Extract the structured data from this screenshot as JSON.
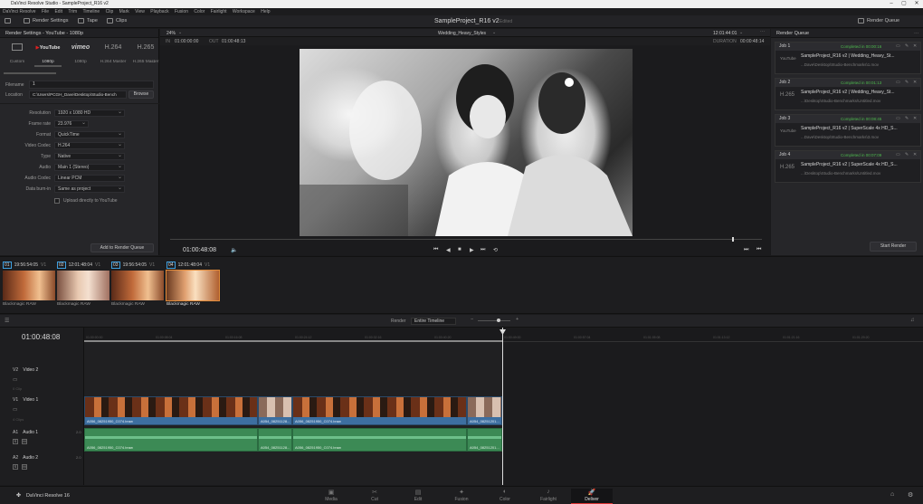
{
  "window": {
    "title": "DaVinci Resolve Studio - SampleProject_R16 v2"
  },
  "menu": [
    "DaVinci Resolve",
    "File",
    "Edit",
    "Trim",
    "Timeline",
    "Clip",
    "Mark",
    "View",
    "Playback",
    "Fusion",
    "Color",
    "Fairlight",
    "Workspace",
    "Help"
  ],
  "toolbar": {
    "render_settings": "Render Settings",
    "tape": "Tape",
    "clips": "Clips",
    "project_title": "SampleProject_R16 v2",
    "edited": "Edited",
    "render_queue": "Render Queue"
  },
  "render_settings": {
    "header": "Render Settings - YouTube - 1080p",
    "presets": [
      {
        "logo": "",
        "name": "Custom"
      },
      {
        "logo": "YouTube",
        "name": "1080p"
      },
      {
        "logo": "vimeo",
        "name": "1080p"
      },
      {
        "logo": "H.264",
        "name": "H.264 Master"
      },
      {
        "logo": "H.265",
        "name": "H.265 Master"
      }
    ],
    "filename_label": "Filename",
    "filename_value": "1",
    "location_label": "Location",
    "location_value": "C:\\Users\\PCGH_Dave\\Desktop\\Studio-Bench",
    "browse": "Browse",
    "fields": [
      {
        "label": "Resolution",
        "value": "1920 x 1080 HD"
      },
      {
        "label": "Frame rate",
        "value": "23.976"
      },
      {
        "label": "Format",
        "value": "QuickTime"
      },
      {
        "label": "Video Codec",
        "value": "H.264"
      },
      {
        "label": "Type",
        "value": "Native"
      },
      {
        "label": "Audio",
        "value": "Main 1 (Stereo)"
      },
      {
        "label": "Audio Codec",
        "value": "Linear PCM"
      },
      {
        "label": "Data burn-in",
        "value": "Same as project"
      }
    ],
    "upload_label": "Upload directly to YouTube",
    "add_to_queue": "Add to Render Queue"
  },
  "viewer": {
    "zoom": "24%",
    "timeline_name": "Wedding_Heavy_Styles",
    "timecode_top": "12:01:44:01",
    "in_label": "IN",
    "in_tc": "01:00:00:00",
    "out_label": "OUT",
    "out_tc": "01:00:48:13",
    "duration_label": "DURATION",
    "duration_tc": "00:00:48:14",
    "current_tc": "01:00:48:08"
  },
  "queue": {
    "header": "Render Queue",
    "jobs": [
      {
        "id": "Job 1",
        "status": "Completed in 00:00:16",
        "title": "SampleProject_R16 v2 | Wedding_Heavy_St...",
        "path": "...Dave\\Desktop\\Studio-Benchmarks\\1.mov",
        "logo": "YouTube"
      },
      {
        "id": "Job 2",
        "status": "Completed in 00:01:13",
        "title": "SampleProject_R16 v2 | Wedding_Heavy_St...",
        "path": "...\\Desktop\\Studio-Benchmarks\\Untitled.mov",
        "logo": "H.265"
      },
      {
        "id": "Job 3",
        "status": "Completed in 00:08:45",
        "title": "SampleProject_R16 v2 | SuperScale 4x HD_S...",
        "path": "...Dave\\Desktop\\Studio-Benchmarks\\3.mov",
        "logo": "YouTube"
      },
      {
        "id": "Job 4",
        "status": "Completed in 00:07:09",
        "title": "SampleProject_R16 v2 | SuperScale 4x HD_S...",
        "path": "...\\Desktop\\Studio-Benchmarks\\Untitled.mov",
        "logo": "H.265"
      }
    ],
    "start_render": "Start Render"
  },
  "clips": [
    {
      "num": "01",
      "tc": "19:56:54:05",
      "track": "V1",
      "name": "Blackmagic RAW"
    },
    {
      "num": "02",
      "tc": "12:01:48:04",
      "track": "V1",
      "name": "Blackmagic RAW"
    },
    {
      "num": "03",
      "tc": "19:56:54:05",
      "track": "V1",
      "name": "Blackmagic RAW"
    },
    {
      "num": "04",
      "tc": "12:01:48:04",
      "track": "V1",
      "name": "Blackmagic RAW"
    }
  ],
  "timeline": {
    "render_label": "Render",
    "render_mode": "Entire Timeline",
    "current_tc": "01:00:48:08",
    "ruler": [
      "01:00:00:00",
      "01:00:08:04",
      "01:00:16:08",
      "01:00:24:12",
      "01:00:32:16",
      "01:00:40:20",
      "01:00:49:00",
      "01:00:57:04",
      "01:01:05:08",
      "01:01:13:12",
      "01:01:21:16",
      "01:01:29:20"
    ],
    "tracks": {
      "v2": {
        "tag": "V2",
        "name": "Video 2",
        "clips_count": "0 Clip"
      },
      "v1": {
        "tag": "V1",
        "name": "Video 1",
        "clips_count": "4 Clips"
      },
      "a1": {
        "tag": "A1",
        "name": "Audio 1",
        "ch": "2.0"
      },
      "a2": {
        "tag": "A2",
        "name": "Audio 2",
        "ch": "2.0"
      }
    },
    "video_clips": [
      "A056_08251950_C074.braw",
      "A054_08251128...",
      "A056_08251950_C074.braw",
      "A054_08251201..."
    ],
    "audio_clips": [
      "A056_08251950_C074.braw",
      "A054_08251128...",
      "A056_08251950_C074.braw",
      "A054_08251201..."
    ],
    "s": "S",
    "m": "M"
  },
  "footer": {
    "app": "DaVinci Resolve 16",
    "pages": [
      "Media",
      "Cut",
      "Edit",
      "Fusion",
      "Color",
      "Fairlight",
      "Deliver"
    ]
  },
  "colors": {
    "accent": "#e03030",
    "status_green": "#4db84d",
    "clip_blue": "#3d6fa0",
    "audio_green": "#3c8a55"
  }
}
